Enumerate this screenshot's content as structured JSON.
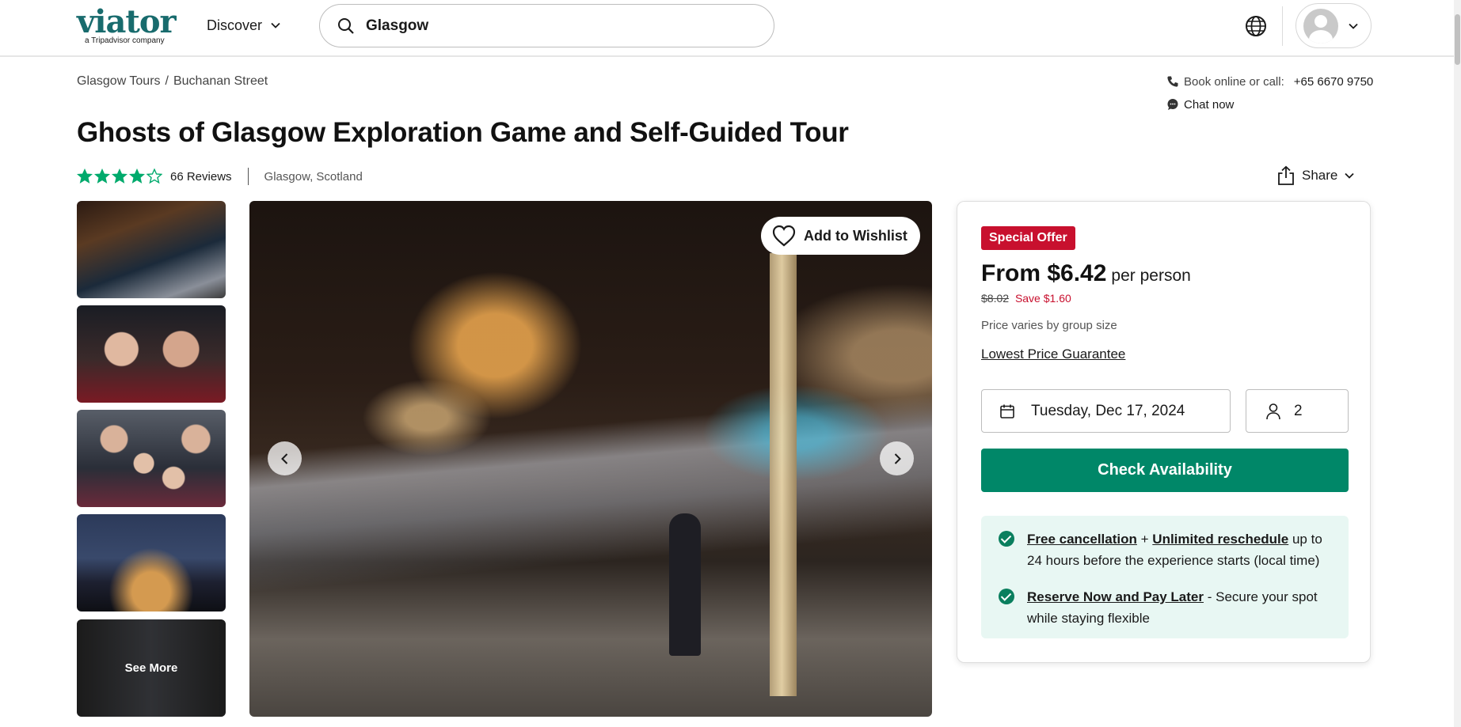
{
  "header": {
    "logo_text": "viator",
    "logo_sub": "a Tripadvisor company",
    "discover_label": "Discover",
    "search_value": "Glasgow"
  },
  "breadcrumb": [
    "Glasgow Tours",
    "/",
    "Buchanan Street"
  ],
  "contact": {
    "book_label": "Book online or call:",
    "phone": "+65 6670 9750",
    "chat_label": "Chat now"
  },
  "product": {
    "title": "Ghosts of Glasgow Exploration Game and Self-Guided Tour",
    "rating": 4,
    "rating_max": 5,
    "reviews_label": "66 Reviews",
    "location": "Glasgow, Scotland",
    "share_label": "Share"
  },
  "gallery": {
    "wishlist_label": "Add to Wishlist",
    "see_more_label": "See More",
    "thumbnail_count": 5
  },
  "booking": {
    "badge": "Special Offer",
    "price": "From $6.42",
    "per_person": "per person",
    "was_price": "$8.02",
    "save_text": "Save $1.60",
    "price_note": "Price varies by group size",
    "guarantee_link": "Lowest Price Guarantee",
    "date": "Tuesday, Dec 17, 2024",
    "travelers": "2",
    "check_button": "Check Availability",
    "perk1_link1": "Free cancellation",
    "perk1_plus": "+",
    "perk1_link2": "Unlimited reschedule",
    "perk1_rest": "up to 24 hours before the experience starts (local time)",
    "perk2_link": "Reserve Now and Pay Later",
    "perk2_rest": "- Secure your spot while staying flexible"
  },
  "colors": {
    "brand": "#186b6d",
    "accent_green": "#008768",
    "offer_red": "#c8102e",
    "star_green": "#00aa6c",
    "perk_bg": "#e8f7f3"
  },
  "icons": [
    "search-icon",
    "chevron-down-icon",
    "globe-icon",
    "avatar",
    "phone-icon",
    "chat-icon",
    "star-icon",
    "share-icon",
    "heart-icon",
    "chevron-left-icon",
    "chevron-right-icon",
    "calendar-icon",
    "person-icon",
    "check-circle-icon"
  ]
}
